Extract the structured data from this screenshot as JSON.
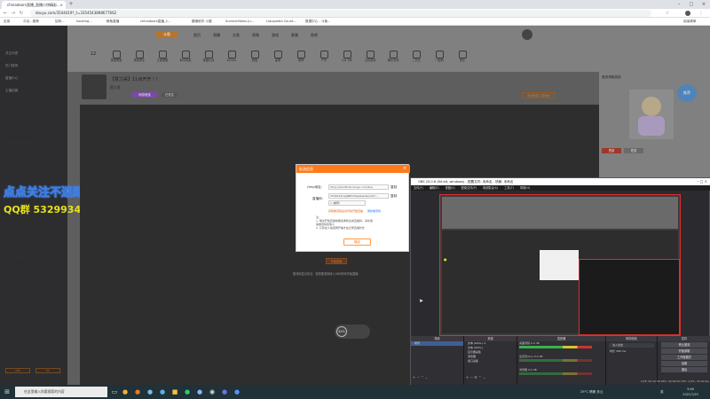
{
  "browser": {
    "tabs": [
      {
        "title": "chinadoors直播_直播小饼精彩..."
      },
      {
        "title": "新标签页"
      }
    ],
    "url": "douyu.com/3544419?_t=3354543898677662",
    "bookmarks": [
      "应用",
      "众议...推荐",
      "如何...",
      "hooking...",
      "鲸鱼直播",
      "chinadoors直播_C...",
      "翻墙软件 小屋",
      "SummerWars Ju...",
      "Liquipedia Count...",
      "数据中心 - 斗鱼..."
    ],
    "right_label": "阅读清单"
  },
  "site": {
    "logo": "斗鱼",
    "nav": [
      "首页",
      "直播",
      "分类",
      "视频",
      "游戏",
      "赛事",
      "鱼吧"
    ],
    "sidebar_items": [
      "关注列表",
      "热门推荐",
      "直播中心",
      "主播招募"
    ],
    "category_nav": [
      "英雄联盟",
      "绝地求生",
      "王者荣耀",
      "和平精英",
      "穿越火线",
      "DOTA2",
      "颜值",
      "星秀",
      "原神",
      "户外",
      "QQ飞车",
      "主机游戏",
      "娱乐天地",
      "二次元",
      "一起看",
      "音乐"
    ],
    "overlay_text_1": "点点关注不迷路",
    "overlay_text_2": "QQ群 532993414",
    "room": {
      "title": "【赞力哥】11点开开 ! !",
      "streamer": "赞力哥",
      "badge": "网游竞技",
      "follow_btn": "已关注",
      "level": "12",
      "gift_label": "房间管理 | 直播间"
    },
    "under_dialog_1": "开始直播",
    "under_dialog_2": "推流码显示在此 · 复制推流码填入OBS即可开始直播",
    "volume": "42%"
  },
  "dialog": {
    "header": "推流信息",
    "rtmp_label": "rtmp地址:",
    "rtmp_value": "rtmp://sendtc3a.douyu.com/live",
    "copy1": "复制",
    "code_label": "直播码:",
    "code_value": "3544419rGgNBhdlhaa&wsSecret=...",
    "copy2": "复制",
    "select_value": "1 (推荐)",
    "link1": "获取推流码后请尽快开始直播",
    "link2": "刷新推流码",
    "notes": [
      "注：",
      "1. 每次开始直播前都会重新生成直播码，请勿泄",
      "   露推流码给他人",
      "2. 只有在斗鱼官网开播才会记录直播时长"
    ],
    "ok": "确定"
  },
  "rightpanel": {
    "login_hint": "登录领取奖励",
    "promo_title": "推荐",
    "side_buttons": [
      "签到",
      "任务"
    ]
  },
  "obs": {
    "title": "OBS 25.0.8 (64-bit, windows) - 配置文件: 未命名 - 场景: 未命名",
    "menu": [
      "文件(F)",
      "编辑(E)",
      "视图(V)",
      "配置文件(P)",
      "场景集合(S)",
      "工具(T)",
      "帮助(H)"
    ],
    "docks": {
      "scenes": {
        "title": "场景",
        "items": [
          "场景"
        ]
      },
      "sources": {
        "title": "来源",
        "items": [
          "文本 (GDI+) 2",
          "文本 (GDI+)",
          "显示器采集",
          "浏览器",
          "窗口采集"
        ]
      },
      "mixer": {
        "title": "混音器",
        "channels": [
          {
            "name": "桌面音频",
            "level": "0.0 dB"
          },
          {
            "name": "麦克风/Aux",
            "level": "0.0 dB"
          },
          {
            "name": "浏览器",
            "level": "0.0 dB"
          }
        ]
      },
      "transitions": {
        "title": "转场特效",
        "value": "淡入淡出",
        "duration_label": "时长",
        "duration": "300 ms"
      },
      "controls": {
        "title": "控件",
        "buttons": [
          "停止推流",
          "开始录制",
          "工作室模式",
          "设置",
          "退出"
        ]
      }
    },
    "status": "LIVE: 00:12:58   REC: 00:00:00   CPU: 4.8%, 30.00 fps"
  },
  "taskbar": {
    "search_placeholder": "在这里输入你要搜索的内容",
    "weather": "29°C 晴朗 多云",
    "time": "9:46",
    "date": "2021/7/29",
    "ime": "英"
  },
  "colors": {
    "accent": "#ff7a1a",
    "obs_red": "#e02d2d",
    "overlay_blue": "#3f7de0",
    "overlay_yellow": "#e7e21a"
  }
}
